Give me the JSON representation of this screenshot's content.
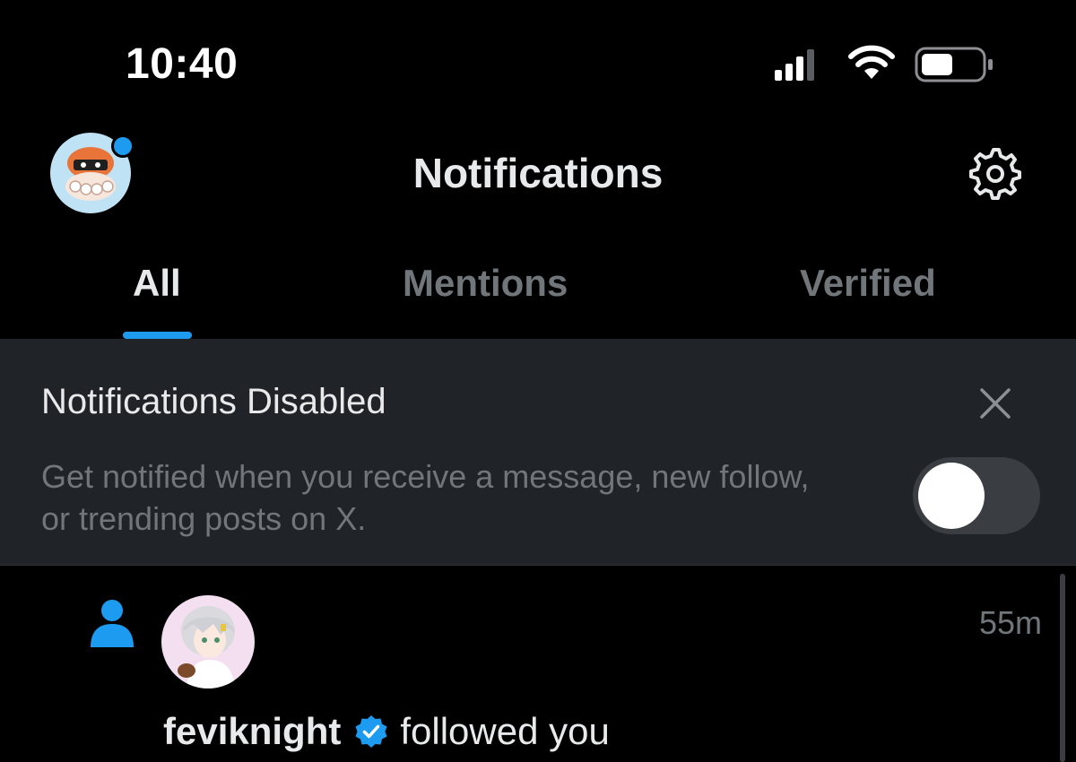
{
  "status_bar": {
    "time": "10:40"
  },
  "header": {
    "title": "Notifications",
    "settings_icon": "gear-icon"
  },
  "tabs": [
    {
      "label": "All",
      "active": true
    },
    {
      "label": "Mentions",
      "active": false
    },
    {
      "label": "Verified",
      "active": false
    }
  ],
  "banner": {
    "title": "Notifications Disabled",
    "description": "Get notified when you receive a message, new follow, or trending posts on X.",
    "toggle_on": false
  },
  "notifications": [
    {
      "type_icon": "person-icon",
      "username": "feviknight",
      "verified": true,
      "action": "followed you",
      "time": "55m"
    }
  ],
  "colors": {
    "background": "#000000",
    "accent": "#1d9bf0",
    "banner_bg": "#202327",
    "text_primary": "#e7e9ea",
    "text_secondary": "#71767b"
  }
}
